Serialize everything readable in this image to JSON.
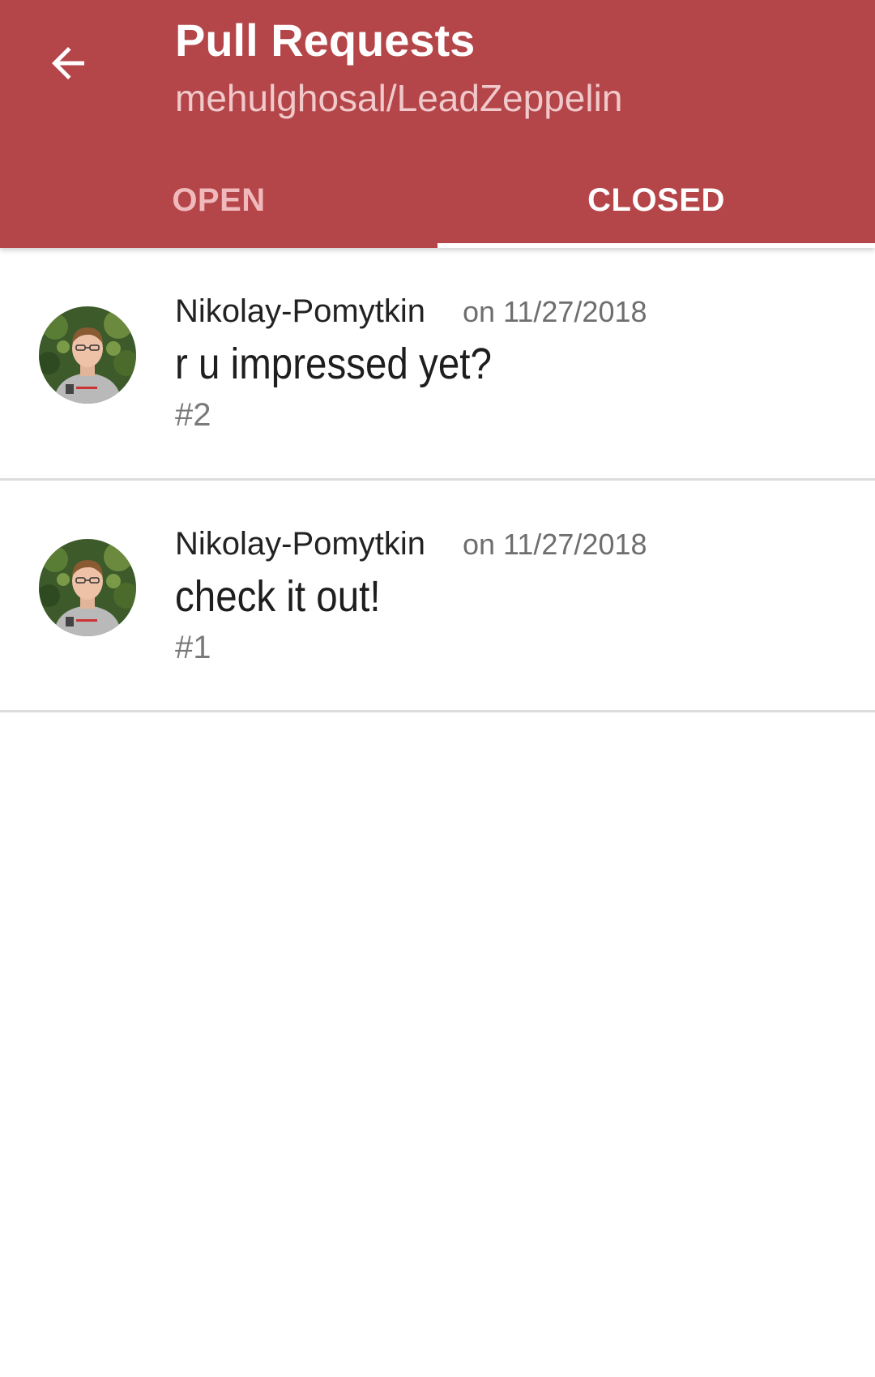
{
  "appbar": {
    "title": "Pull Requests",
    "subtitle": "mehulghosal/LeadZeppelin",
    "back_icon": "arrow-left-icon",
    "color": "#b44549"
  },
  "tabs": [
    {
      "label": "OPEN",
      "selected": false
    },
    {
      "label": "CLOSED",
      "selected": true
    }
  ],
  "pull_requests": [
    {
      "author": "Nikolay-Pomytkin",
      "date": "on 11/27/2018",
      "title": "r u impressed yet?",
      "number": "#2",
      "avatar_icon": "user-avatar-photo"
    },
    {
      "author": "Nikolay-Pomytkin",
      "date": "on 11/27/2018",
      "title": "check it out!",
      "number": "#1",
      "avatar_icon": "user-avatar-photo"
    }
  ]
}
